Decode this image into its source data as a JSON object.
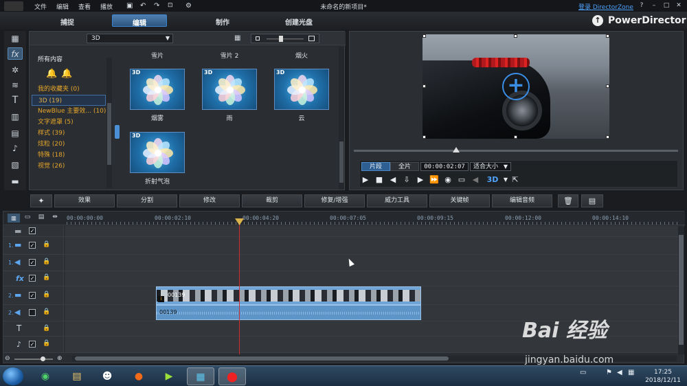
{
  "menu": {
    "items": [
      "文件",
      "编辑",
      "查看",
      "播放"
    ]
  },
  "window": {
    "title": "未命名的新项目*",
    "directorzone_link": "登录 DirectorZone",
    "help": "?",
    "minimize": "–",
    "maximize": "□",
    "close": "✕"
  },
  "main_tabs": {
    "capture": "捕捉",
    "edit": "编辑",
    "produce": "制作",
    "create_disc": "创建光盘"
  },
  "brand": {
    "name": "PowerDirector"
  },
  "library": {
    "dropdown_value": "3D",
    "category_header": "所有内容",
    "categories": [
      {
        "label": "我的收藏夹  (0)"
      },
      {
        "label": "3D  (19)"
      },
      {
        "label": "NewBlue 主要效...  (10)"
      },
      {
        "label": "文字遮罩  (5)"
      },
      {
        "label": "样式  (39)"
      },
      {
        "label": "炫粒  (20)"
      },
      {
        "label": "特殊  (18)"
      },
      {
        "label": "视觉  (26)"
      }
    ],
    "column_headers": [
      "雪片",
      "雪片 2",
      "烟火"
    ],
    "effects": [
      {
        "badge": "3D",
        "label": "烟雾"
      },
      {
        "badge": "3D",
        "label": "雨"
      },
      {
        "badge": "3D",
        "label": "云"
      },
      {
        "badge": "3D",
        "label": "折射气泡"
      }
    ]
  },
  "preview": {
    "mode_clip": "片段",
    "mode_full": "全片",
    "timecode": "00:00:02:07",
    "fit_option": "适合大小",
    "stereo_label": "3D"
  },
  "edit_toolbar": [
    "效果",
    "分割",
    "修改",
    "裁剪",
    "修复/增强",
    "威力工具",
    "关键帧",
    "编辑音频"
  ],
  "timeline": {
    "ruler_labels": [
      "00:00:00:00",
      "00:00:02:10",
      "00:00:04:20",
      "00:00:07:05",
      "00:00:09:15",
      "00:00:12:00",
      "00:00:14:10"
    ],
    "tracks": [
      {
        "num": "",
        "icon": "video-track-icon"
      },
      {
        "num": "1.",
        "icon": "video-track-icon"
      },
      {
        "num": "1.",
        "icon": "audio-track-icon"
      },
      {
        "num": "",
        "icon": "fx-track-icon"
      },
      {
        "num": "2.",
        "icon": "video-track-icon"
      },
      {
        "num": "2.",
        "icon": "audio-track-icon"
      },
      {
        "num": "",
        "icon": "title-track-icon"
      },
      {
        "num": "",
        "icon": "voice-track-icon"
      }
    ],
    "video_clip_label": "00139",
    "audio_clip_label": "00139"
  },
  "taskbar": {
    "clock_time": "17:25",
    "clock_date": "2018/12/11"
  },
  "watermark": {
    "main": "Bai  经验",
    "url": "jingyan.baidu.com"
  },
  "colors": {
    "accent": "#3a85d4",
    "category_text": "#e6a72c",
    "playhead": "#d12f2f",
    "clip_blue": "#6fa5d6"
  }
}
